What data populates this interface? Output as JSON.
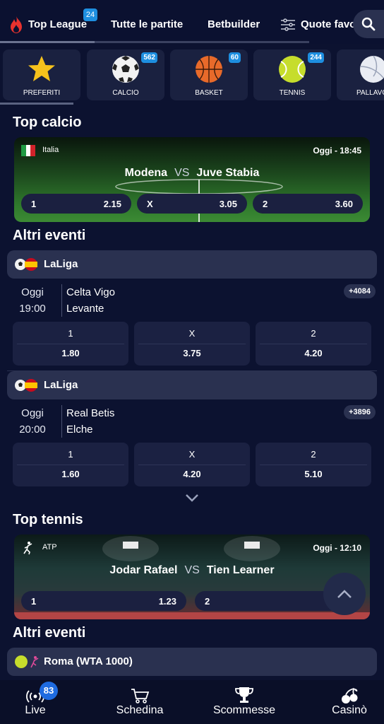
{
  "top_tabs": {
    "items": [
      {
        "label": "Top League",
        "badge": "24"
      },
      {
        "label": "Tutte le partite"
      },
      {
        "label": "Betbuilder"
      },
      {
        "label": "Quote favo"
      }
    ]
  },
  "sports": [
    {
      "label": "PREFERITI",
      "count": "",
      "icon": "star-icon"
    },
    {
      "label": "CALCIO",
      "count": "562",
      "icon": "soccer-ball-icon"
    },
    {
      "label": "BASKET",
      "count": "60",
      "icon": "basketball-icon"
    },
    {
      "label": "TENNIS",
      "count": "244",
      "icon": "tennis-ball-icon"
    },
    {
      "label": "PALLAVO",
      "count": "",
      "icon": "volleyball-icon"
    }
  ],
  "top_calcio": {
    "title": "Top calcio",
    "league": "Italia",
    "time": "Oggi - 18:45",
    "home": "Modena",
    "vs": "VS",
    "away": "Juve Stabia",
    "odds": [
      {
        "k": "1",
        "v": "2.15"
      },
      {
        "k": "X",
        "v": "3.05"
      },
      {
        "k": "2",
        "v": "3.60"
      }
    ]
  },
  "altri_eventi_title": "Altri eventi",
  "events": [
    {
      "league": "LaLiga",
      "day": "Oggi",
      "time": "19:00",
      "home": "Celta Vigo",
      "away": "Levante",
      "more": "+4084",
      "odds": [
        {
          "k": "1",
          "v": "1.80"
        },
        {
          "k": "X",
          "v": "3.75"
        },
        {
          "k": "2",
          "v": "4.20"
        }
      ]
    },
    {
      "league": "LaLiga",
      "day": "Oggi",
      "time": "20:00",
      "home": "Real Betis",
      "away": "Elche",
      "more": "+3896",
      "odds": [
        {
          "k": "1",
          "v": "1.60"
        },
        {
          "k": "X",
          "v": "4.20"
        },
        {
          "k": "2",
          "v": "5.10"
        }
      ]
    }
  ],
  "top_tennis": {
    "title": "Top tennis",
    "league": "ATP",
    "time": "Oggi - 12:10",
    "home": "Jodar Rafael",
    "vs": "VS",
    "away": "Tien Learner",
    "odds": [
      {
        "k": "1",
        "v": "1.23"
      },
      {
        "k": "2",
        "v": ""
      }
    ]
  },
  "altri_eventi_tennis_title": "Altri eventi",
  "tennis_league": "Roma (WTA 1000)",
  "bottom_nav": {
    "live": "Live",
    "live_badge": "83",
    "schedina": "Schedina",
    "scommesse": "Scommesse",
    "casino": "Casinò"
  },
  "colors": {
    "background": "#0c1230",
    "card": "#1b2142",
    "bar": "#2a3150",
    "badge": "#1e8fe0"
  }
}
